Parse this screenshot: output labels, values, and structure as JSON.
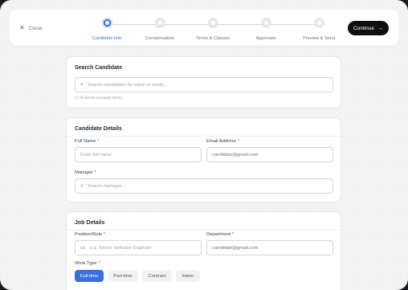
{
  "header": {
    "close_label": "Close",
    "continue_label": "Continue",
    "steps": [
      {
        "label": "Candidate Info",
        "active": true
      },
      {
        "label": "Compensation",
        "active": false
      },
      {
        "label": "Terms & Clauses",
        "active": false
      },
      {
        "label": "Approvals",
        "active": false
      },
      {
        "label": "Preview & Send",
        "active": false
      }
    ]
  },
  "search_card": {
    "title": "Search Candidate",
    "search_placeholder": "Search candidates by name or email...",
    "hint": "Or fill details manually below."
  },
  "details_card": {
    "title": "Candidate Details",
    "full_name_label": "Full Name",
    "full_name_placeholder": "Enter full name",
    "email_label": "Email Address",
    "email_value": "candidate@gmail.com",
    "manager_label": "Manager",
    "manager_placeholder": "Search manager..."
  },
  "job_card": {
    "title": "Job Details",
    "position_label": "Position/Role",
    "position_placeholder": "e.g. Senior Software Engineer",
    "department_label": "Department",
    "department_value": "candidate@gmail.com",
    "work_type_label": "Work Type",
    "work_types": [
      "Full-time",
      "Part-time",
      "Contract",
      "Intern"
    ],
    "selected_work_type": "Full-time"
  },
  "required_marker": "*",
  "colors": {
    "accent": "#3b6fe0",
    "primary_button": "#0f0f10",
    "required": "#e11d48"
  }
}
